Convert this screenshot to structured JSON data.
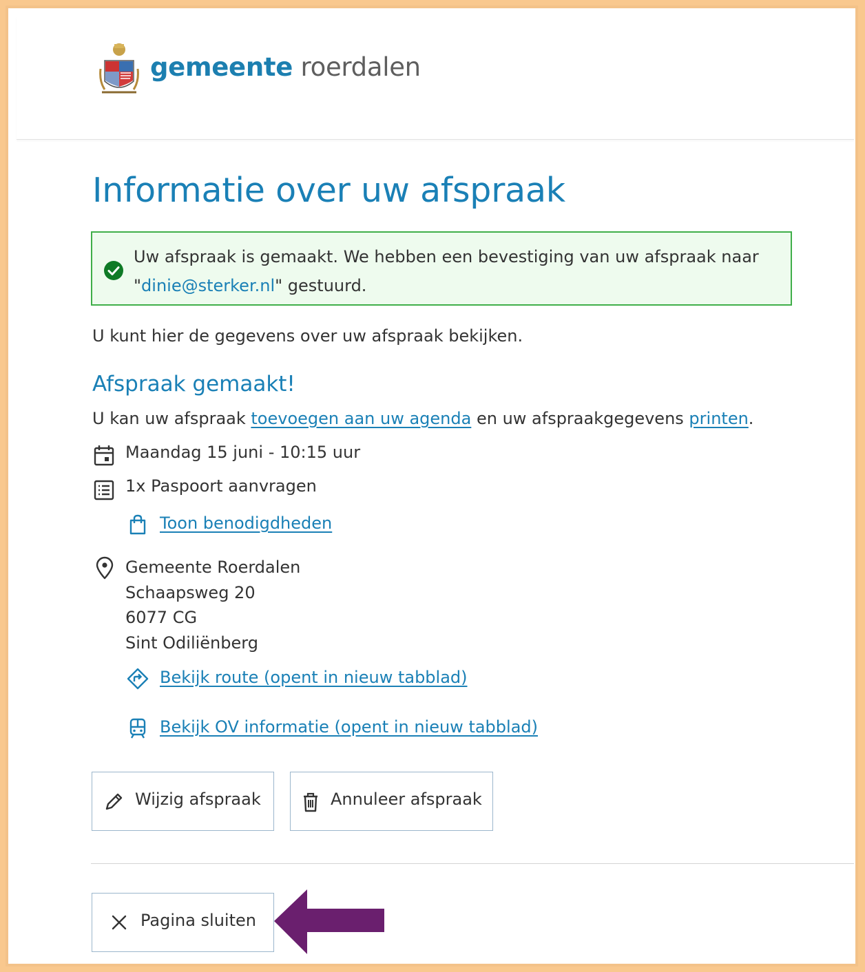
{
  "header": {
    "brand_bold": "gemeente",
    "brand_light": "roerdalen"
  },
  "page_title": "Informatie over uw afspraak",
  "alert": {
    "text_before": "Uw afspraak is gemaakt. We hebben een bevestiging van uw afspraak naar \"",
    "email": "dinie@sterker.nl",
    "text_after": "\" gestuurd."
  },
  "lead": "U kunt hier de gegevens over uw afspraak bekijken.",
  "subtitle": "Afspraak gemaakt!",
  "intro": {
    "before": "U kan uw afspraak ",
    "agenda_link": "toevoegen aan uw agenda",
    "middle": " en uw afspraakgegevens ",
    "print_link": "printen",
    "after": "."
  },
  "details": {
    "datetime": "Maandag 15 juni - 10:15 uur",
    "product": "1x Paspoort aanvragen",
    "requirements_link": "Toon benodigdheden"
  },
  "location": {
    "name": "Gemeente Roerdalen",
    "street": "Schaapsweg 20",
    "postcode": "6077 CG",
    "city": "Sint Odiliënberg",
    "route_link": "Bekijk route (opent in nieuw tabblad)",
    "ov_link": "Bekijk OV informatie (opent in nieuw tabblad)"
  },
  "buttons": {
    "change": "Wijzig afspraak",
    "cancel": "Annuleer afspraak",
    "close": "Pagina sluiten"
  },
  "colors": {
    "brand_blue": "#1a80b6",
    "success_green": "#3fae49",
    "frame_orange": "#f9c88e",
    "arrow_purple": "#6a1f6e"
  }
}
